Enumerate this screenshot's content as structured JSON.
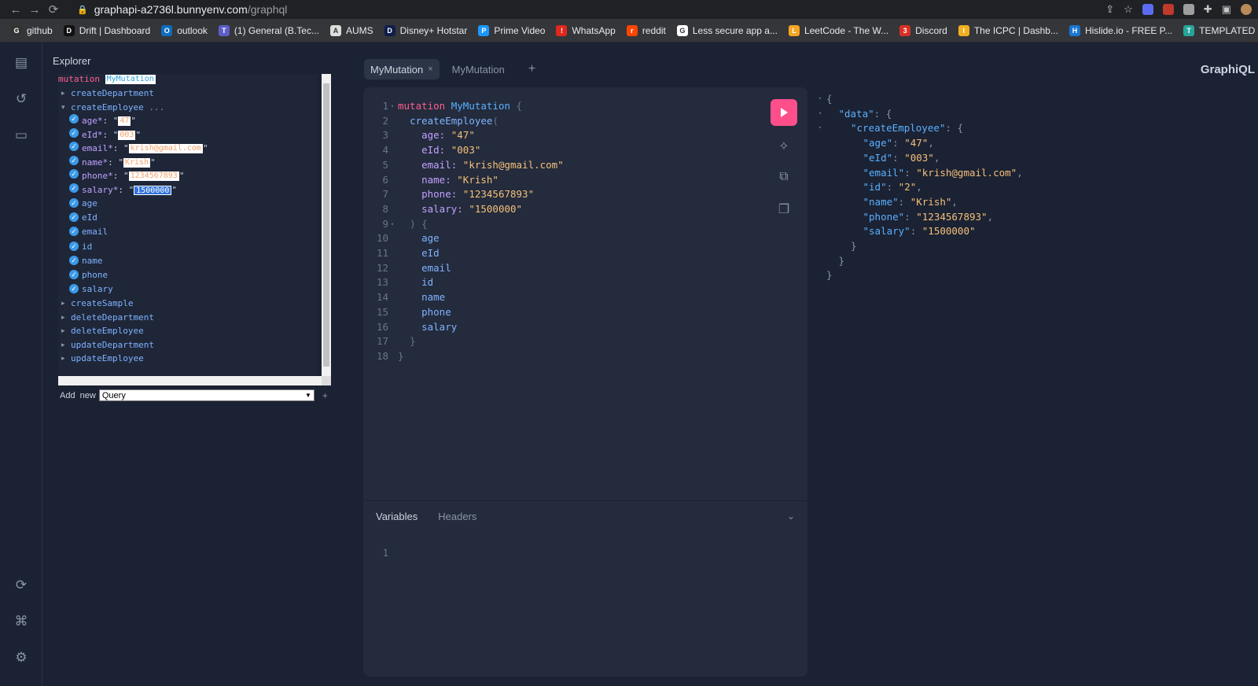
{
  "browser": {
    "url_host": "graphapi-a2736l.bunnyenv.com",
    "url_path": "/graphql",
    "bookmarks": [
      {
        "label": "github",
        "color": "#333333",
        "glyph": "G"
      },
      {
        "label": "Drift | Dashboard",
        "color": "#111111",
        "glyph": "D"
      },
      {
        "label": "outlook",
        "color": "#0f6cbd",
        "glyph": "O"
      },
      {
        "label": "(1) General (B.Tec...",
        "color": "#5b5fc7",
        "glyph": "T"
      },
      {
        "label": "AUMS",
        "color": "#dddddd",
        "glyph": "A"
      },
      {
        "label": "Disney+ Hotstar",
        "color": "#0f1d4a",
        "glyph": "D"
      },
      {
        "label": "Prime Video",
        "color": "#1a98ff",
        "glyph": "P"
      },
      {
        "label": "WhatsApp",
        "color": "#e0281d",
        "glyph": "!"
      },
      {
        "label": "reddit",
        "color": "#ff4500",
        "glyph": "r"
      },
      {
        "label": "Less secure app a...",
        "color": "#ffffff",
        "glyph": "G"
      },
      {
        "label": "LeetCode - The W...",
        "color": "#f5a623",
        "glyph": "L"
      },
      {
        "label": "Discord",
        "color": "#d93025",
        "glyph": "3"
      },
      {
        "label": "The ICPC | Dashb...",
        "color": "#f2b01e",
        "glyph": "I"
      },
      {
        "label": "Hislide.io - FREE P...",
        "color": "#1976d2",
        "glyph": "H"
      },
      {
        "label": "TEMPLATED - Fre...",
        "color": "#26a69a",
        "glyph": "T"
      }
    ]
  },
  "explorer": {
    "title": "Explorer",
    "operation_keyword": "mutation",
    "operation_name": "MyMutation",
    "fields_top": [
      "createDepartment"
    ],
    "open_field": "createEmployee",
    "open_field_suffix": "...",
    "args": [
      {
        "label": "age*",
        "value": "47"
      },
      {
        "label": "eId*",
        "value": "003"
      },
      {
        "label": "email*",
        "value": "krish@gmail.com"
      },
      {
        "label": "name*",
        "value": "Krish"
      },
      {
        "label": "phone*",
        "value": "1234567893"
      },
      {
        "label": "salary*",
        "value": "1500000"
      }
    ],
    "selected_fields": [
      "age",
      "eId",
      "email",
      "id",
      "name",
      "phone",
      "salary"
    ],
    "fields_bottom": [
      "createSample",
      "deleteDepartment",
      "deleteEmployee",
      "updateDepartment",
      "updateEmployee"
    ],
    "add_new_label": "Add  new",
    "add_new_selected": "Query"
  },
  "tabs": {
    "items": [
      "MyMutation",
      "MyMutation"
    ],
    "close_glyph": "×",
    "new_glyph": "+"
  },
  "logo": "GraphiQL",
  "editor": {
    "lines": [
      "mutation MyMutation {",
      "  createEmployee(",
      "    age: \"47\"",
      "    eId: \"003\"",
      "    email: \"krish@gmail.com\"",
      "    name: \"Krish\"",
      "    phone: \"1234567893\"",
      "    salary: \"1500000\"",
      "  ) {",
      "    age",
      "    eId",
      "    email",
      "    id",
      "    name",
      "    phone",
      "    salary",
      "  }",
      "}"
    ],
    "variables_tab": "Variables",
    "headers_tab": "Headers",
    "variables_line": "1"
  },
  "result": {
    "data_key": "\"data\"",
    "create_key": "\"createEmployee\"",
    "fields": [
      {
        "key": "\"age\"",
        "value": "\"47\""
      },
      {
        "key": "\"eId\"",
        "value": "\"003\""
      },
      {
        "key": "\"email\"",
        "value": "\"krish@gmail.com\""
      },
      {
        "key": "\"id\"",
        "value": "\"2\""
      },
      {
        "key": "\"name\"",
        "value": "\"Krish\""
      },
      {
        "key": "\"phone\"",
        "value": "\"1234567893\""
      },
      {
        "key": "\"salary\"",
        "value": "\"1500000\""
      }
    ]
  },
  "colors": {
    "run_button": "#ff4f8b",
    "keyword": "#ff5d8f",
    "string": "#f5c07a",
    "field": "#7fb3ff"
  }
}
